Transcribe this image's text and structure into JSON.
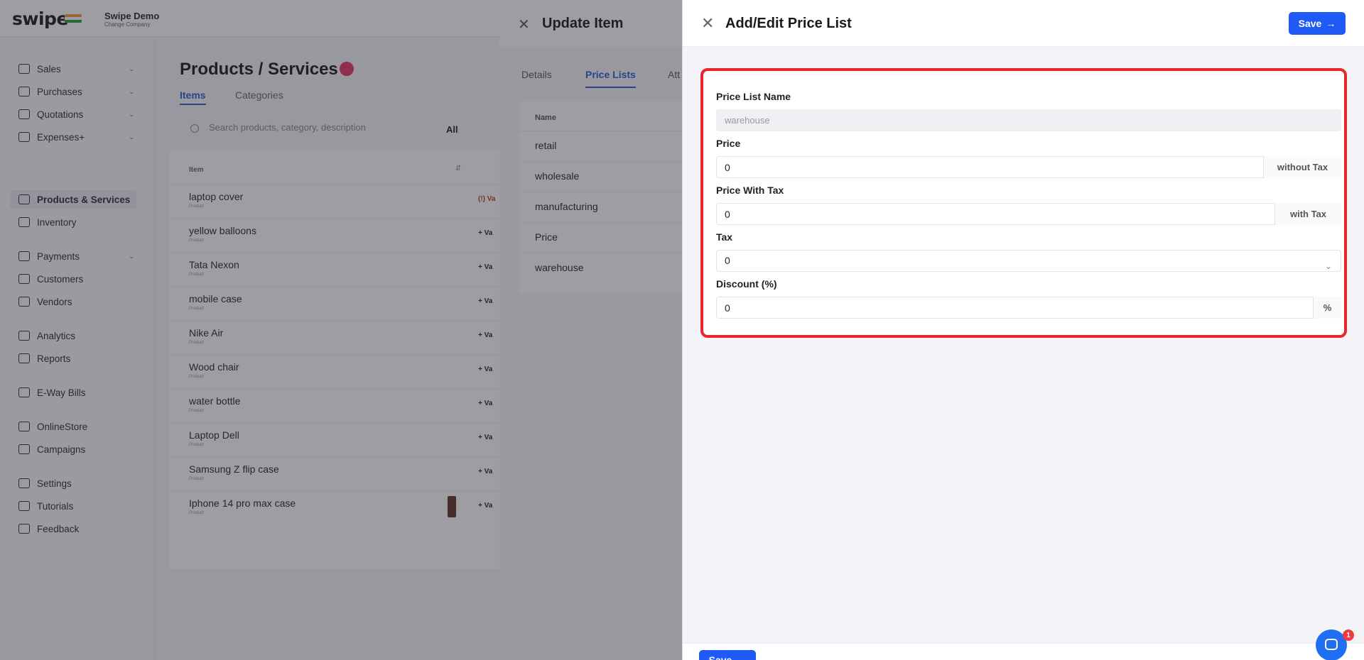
{
  "topbar": {
    "logo": "swipe",
    "company_name": "Swipe Demo",
    "company_sub": "Change Company"
  },
  "sidebar": {
    "items": [
      {
        "label": "Sales",
        "icon": "sales-icon"
      },
      {
        "label": "Purchases",
        "icon": "cart-icon"
      },
      {
        "label": "Quotations",
        "icon": "pencil-icon"
      },
      {
        "label": "Expenses+",
        "icon": "tag-icon"
      },
      {
        "label": "Products & Services",
        "icon": "barcode-icon"
      },
      {
        "label": "Inventory",
        "icon": "inventory-icon"
      },
      {
        "label": "Payments",
        "icon": "rupee-icon"
      },
      {
        "label": "Customers",
        "icon": "user-icon"
      },
      {
        "label": "Vendors",
        "icon": "users-icon"
      },
      {
        "label": "Analytics",
        "icon": "chart-icon"
      },
      {
        "label": "Reports",
        "icon": "report-icon"
      },
      {
        "label": "E-Way Bills",
        "icon": "truck-icon"
      },
      {
        "label": "OnlineStore",
        "icon": "store-icon"
      },
      {
        "label": "Campaigns",
        "icon": "megaphone-icon"
      },
      {
        "label": "Settings",
        "icon": "gear-icon"
      },
      {
        "label": "Tutorials",
        "icon": "youtube-icon"
      },
      {
        "label": "Feedback",
        "icon": "chat-icon"
      }
    ]
  },
  "main": {
    "title": "Products / Services",
    "tabs": [
      "Items",
      "Categories"
    ],
    "search_placeholder": "Search products, category, description",
    "filter": "All",
    "list_header": "Item",
    "items": [
      {
        "name": "laptop cover",
        "type": "Product",
        "action": "(!) Va"
      },
      {
        "name": "yellow balloons",
        "type": "Product",
        "action": "+ Va"
      },
      {
        "name": "Tata Nexon",
        "type": "Product",
        "action": "+ Va"
      },
      {
        "name": "mobile case",
        "type": "Product",
        "action": "+ Va"
      },
      {
        "name": "Nike Air",
        "type": "Product",
        "action": "+ Va"
      },
      {
        "name": "Wood chair",
        "type": "Product",
        "action": "+ Va"
      },
      {
        "name": "water bottle",
        "type": "Product",
        "action": "+ Va"
      },
      {
        "name": "Laptop Dell",
        "type": "Product",
        "action": "+ Va"
      },
      {
        "name": "Samsung Z flip case",
        "type": "Product",
        "action": "+ Va"
      },
      {
        "name": "Iphone 14 pro max case",
        "type": "Product",
        "action": "+ Va"
      }
    ]
  },
  "update_item": {
    "title": "Update Item",
    "tabs": [
      "Details",
      "Price Lists",
      "Att"
    ],
    "list_header": "Name",
    "price_lists": [
      "retail",
      "wholesale",
      "manufacturing",
      "Price",
      "warehouse"
    ]
  },
  "price_list_form": {
    "title": "Add/Edit Price List",
    "save_label": "Save",
    "fields": {
      "name": {
        "label": "Price List Name",
        "value": "warehouse"
      },
      "price": {
        "label": "Price",
        "value": "0",
        "suffix": "without Tax"
      },
      "price_with_tax": {
        "label": "Price With Tax",
        "value": "0",
        "suffix": "with Tax"
      },
      "tax": {
        "label": "Tax",
        "value": "0"
      },
      "discount": {
        "label": "Discount (%)",
        "value": "0",
        "suffix": "%"
      }
    }
  },
  "chat": {
    "badge": "1"
  },
  "colors": {
    "primary": "#1f5af6",
    "highlight": "#e8262e"
  }
}
